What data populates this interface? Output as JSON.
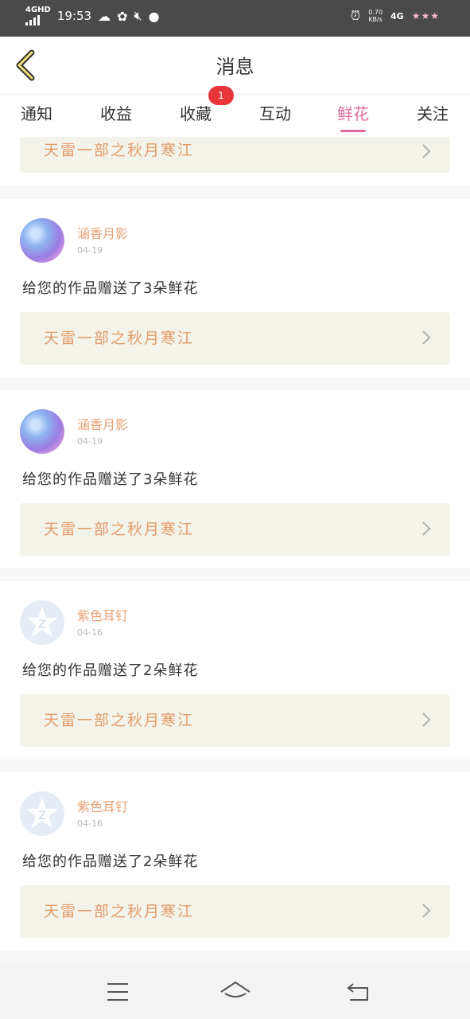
{
  "status_bar": {
    "network": "4GHD",
    "time": "19:53",
    "speed": "0.70",
    "speed_unit": "KB/s",
    "network_right": "4G",
    "icons": [
      "cloud-icon",
      "wechat-icon",
      "mute-icon",
      "chat-bubble-icon",
      "alarm-icon"
    ]
  },
  "header": {
    "title": "消息"
  },
  "tabs": [
    {
      "label": "通知"
    },
    {
      "label": "收益"
    },
    {
      "label": "收藏"
    },
    {
      "label": "互动"
    },
    {
      "label": "鲜花"
    },
    {
      "label": "关注"
    }
  ],
  "active_tab": "鲜花",
  "badge": {
    "count": "1"
  },
  "partial_card": {
    "work_title": "天雷一部之秋月寒江"
  },
  "messages": [
    {
      "user": "涵香月影",
      "date": "04-19",
      "text": "给您的作品赠送了3朵鲜花",
      "work_title": "天雷一部之秋月寒江"
    },
    {
      "user": "涵香月影",
      "date": "04-19",
      "text": "给您的作品赠送了3朵鲜花",
      "work_title": "天雷一部之秋月寒江"
    },
    {
      "user": "紫色耳钉",
      "date": "04-16",
      "text": "给您的作品赠送了2朵鲜花",
      "work_title": "天雷一部之秋月寒江"
    },
    {
      "user": "紫色耳钉",
      "date": "04-16",
      "text": "给您的作品赠送了2朵鲜花",
      "work_title": "天雷一部之秋月寒江"
    }
  ],
  "colors": {
    "accent": "#e06aa0",
    "badge": "#e8353a",
    "username": "#e7a276",
    "work_bg": "#f4f3ea"
  }
}
